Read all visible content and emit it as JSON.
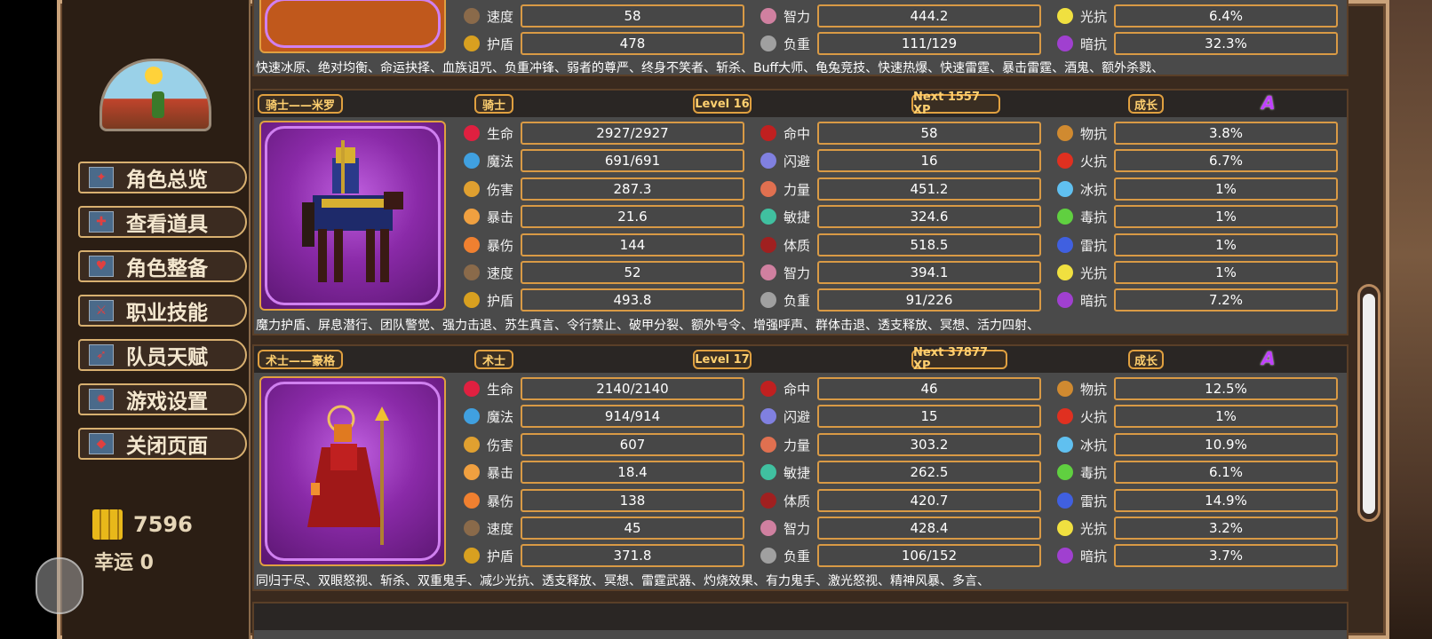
{
  "sidebar": {
    "menu": [
      {
        "label": "角色总览",
        "icon": "overview-icon"
      },
      {
        "label": "查看道具",
        "icon": "items-icon"
      },
      {
        "label": "角色整备",
        "icon": "equip-icon"
      },
      {
        "label": "职业技能",
        "icon": "skills-icon"
      },
      {
        "label": "队员天赋",
        "icon": "talent-icon"
      },
      {
        "label": "游戏设置",
        "icon": "settings-icon"
      },
      {
        "label": "关闭页面",
        "icon": "close-icon"
      }
    ],
    "gold": "7596",
    "luck": "幸运 0"
  },
  "top_partial": {
    "stats": [
      {
        "label": "速度",
        "value": "58",
        "color": "#8a6a4a"
      },
      {
        "label": "护盾",
        "value": "478",
        "color": "#d8a020"
      },
      {
        "label": "智力",
        "value": "444.2",
        "color": "#d080a0"
      },
      {
        "label": "负重",
        "value": "111/129",
        "color": "#a0a0a0"
      },
      {
        "label": "光抗",
        "value": "6.4%",
        "color": "#f0e040"
      },
      {
        "label": "暗抗",
        "value": "32.3%",
        "color": "#a040d0"
      }
    ],
    "skills": "快速冰原、绝对均衡、命运抉择、血族诅咒、负重冲锋、弱者的尊严、终身不笑者、斩杀、Buff大师、龟兔竞技、快速热爆、快速雷霆、暴击雷霆、酒鬼、额外杀戮、"
  },
  "characters": [
    {
      "name": "骑士——米罗",
      "class": "骑士",
      "level": "Level 16",
      "next": "Next 1557 XP",
      "growth": "成长",
      "grade": "A",
      "col1": [
        {
          "label": "生命",
          "value": "2927/2927",
          "color": "#e02040"
        },
        {
          "label": "魔法",
          "value": "691/691",
          "color": "#40a0e0"
        },
        {
          "label": "伤害",
          "value": "287.3",
          "color": "#e0a030"
        },
        {
          "label": "暴击",
          "value": "21.6",
          "color": "#f0a040"
        },
        {
          "label": "暴伤",
          "value": "144",
          "color": "#f08030"
        },
        {
          "label": "速度",
          "value": "52",
          "color": "#8a6a4a"
        },
        {
          "label": "护盾",
          "value": "493.8",
          "color": "#d8a020"
        }
      ],
      "col2": [
        {
          "label": "命中",
          "value": "58",
          "color": "#c02020"
        },
        {
          "label": "闪避",
          "value": "16",
          "color": "#8080e0"
        },
        {
          "label": "力量",
          "value": "451.2",
          "color": "#e07050"
        },
        {
          "label": "敏捷",
          "value": "324.6",
          "color": "#40c0a0"
        },
        {
          "label": "体质",
          "value": "518.5",
          "color": "#a02020"
        },
        {
          "label": "智力",
          "value": "394.1",
          "color": "#d080a0"
        },
        {
          "label": "负重",
          "value": "91/226",
          "color": "#a0a0a0"
        }
      ],
      "col3": [
        {
          "label": "物抗",
          "value": "3.8%",
          "color": "#d08a30"
        },
        {
          "label": "火抗",
          "value": "6.7%",
          "color": "#e03020"
        },
        {
          "label": "冰抗",
          "value": "1%",
          "color": "#60c0f0"
        },
        {
          "label": "毒抗",
          "value": "1%",
          "color": "#60d040"
        },
        {
          "label": "雷抗",
          "value": "1%",
          "color": "#4060e0"
        },
        {
          "label": "光抗",
          "value": "1%",
          "color": "#f0e040"
        },
        {
          "label": "暗抗",
          "value": "7.2%",
          "color": "#a040d0"
        }
      ],
      "skills": "魔力护盾、屏息潜行、团队警觉、强力击退、苏生真言、令行禁止、破甲分裂、额外号令、增强呼声、群体击退、透支释放、冥想、活力四射、"
    },
    {
      "name": "术士——豪格",
      "class": "术士",
      "level": "Level 17",
      "next": "Next 37877 XP",
      "growth": "成长",
      "grade": "A",
      "col1": [
        {
          "label": "生命",
          "value": "2140/2140",
          "color": "#e02040"
        },
        {
          "label": "魔法",
          "value": "914/914",
          "color": "#40a0e0"
        },
        {
          "label": "伤害",
          "value": "607",
          "color": "#e0a030"
        },
        {
          "label": "暴击",
          "value": "18.4",
          "color": "#f0a040"
        },
        {
          "label": "暴伤",
          "value": "138",
          "color": "#f08030"
        },
        {
          "label": "速度",
          "value": "45",
          "color": "#8a6a4a"
        },
        {
          "label": "护盾",
          "value": "371.8",
          "color": "#d8a020"
        }
      ],
      "col2": [
        {
          "label": "命中",
          "value": "46",
          "color": "#c02020"
        },
        {
          "label": "闪避",
          "value": "15",
          "color": "#8080e0"
        },
        {
          "label": "力量",
          "value": "303.2",
          "color": "#e07050"
        },
        {
          "label": "敏捷",
          "value": "262.5",
          "color": "#40c0a0"
        },
        {
          "label": "体质",
          "value": "420.7",
          "color": "#a02020"
        },
        {
          "label": "智力",
          "value": "428.4",
          "color": "#d080a0"
        },
        {
          "label": "负重",
          "value": "106/152",
          "color": "#a0a0a0"
        }
      ],
      "col3": [
        {
          "label": "物抗",
          "value": "12.5%",
          "color": "#d08a30"
        },
        {
          "label": "火抗",
          "value": "1%",
          "color": "#e03020"
        },
        {
          "label": "冰抗",
          "value": "10.9%",
          "color": "#60c0f0"
        },
        {
          "label": "毒抗",
          "value": "6.1%",
          "color": "#60d040"
        },
        {
          "label": "雷抗",
          "value": "14.9%",
          "color": "#4060e0"
        },
        {
          "label": "光抗",
          "value": "3.2%",
          "color": "#f0e040"
        },
        {
          "label": "暗抗",
          "value": "3.7%",
          "color": "#a040d0"
        }
      ],
      "skills": "同归于尽、双眼怒视、斩杀、双重鬼手、减少光抗、透支释放、冥想、雷霆武器、灼烧效果、有力鬼手、激光怒视、精神风暴、多言、"
    }
  ]
}
